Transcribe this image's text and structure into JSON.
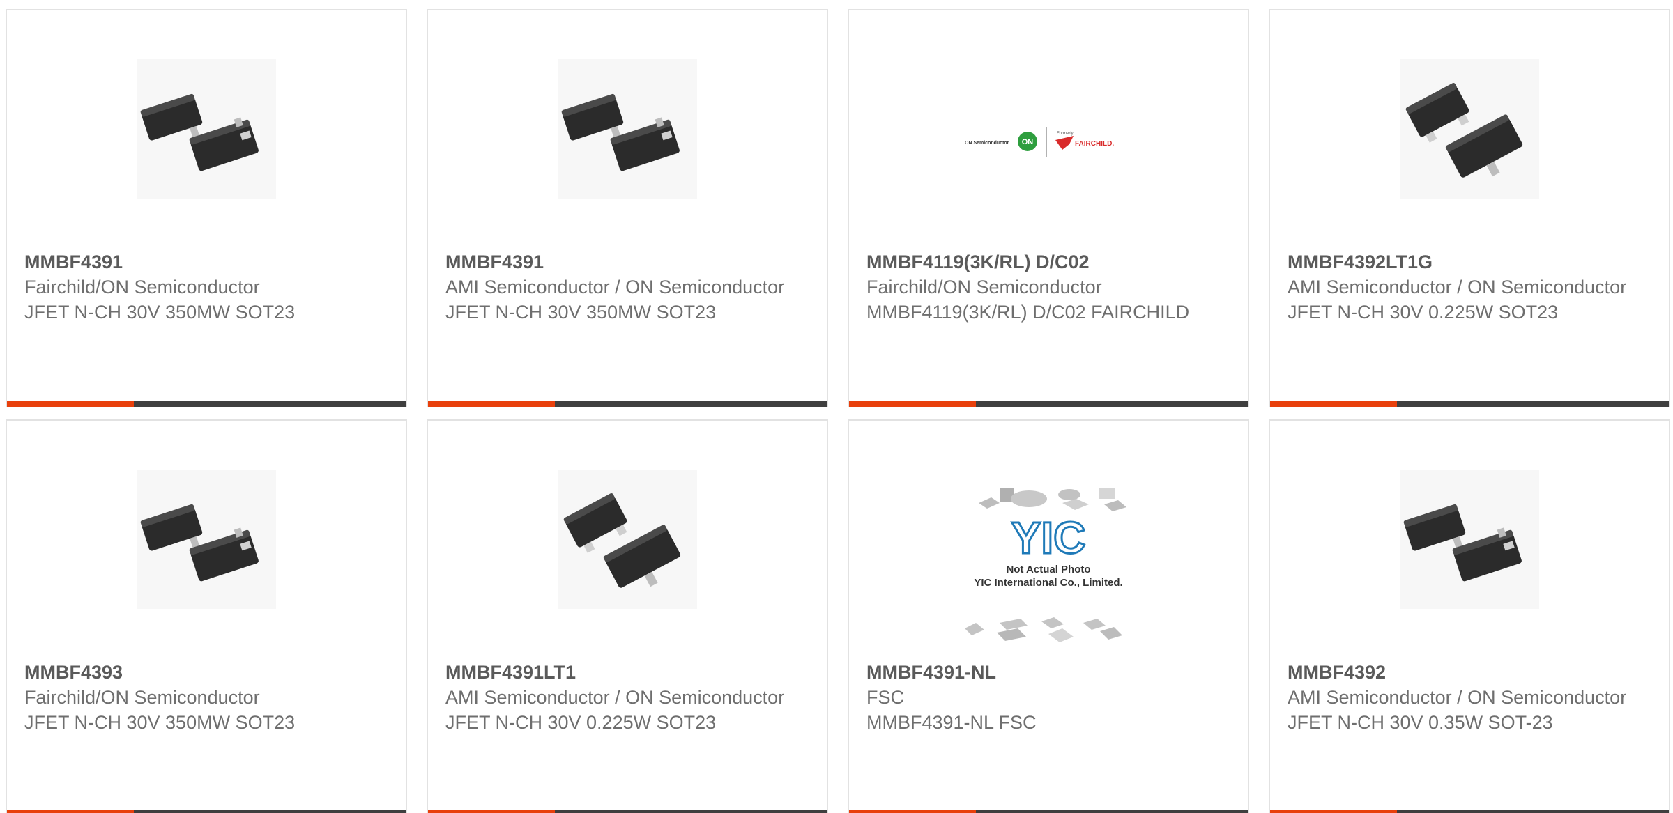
{
  "colors": {
    "accent_bar": "#e8400c",
    "dark_bar": "#3f3f3f",
    "card_border": "#e2e2e2",
    "text": "#6e6e6e"
  },
  "products": [
    {
      "part_number": "MMBF4391",
      "manufacturer": "Fairchild/ON Semiconductor",
      "description": "JFET N-CH 30V 350MW SOT23",
      "image": "sot23-package-icon"
    },
    {
      "part_number": "MMBF4391",
      "manufacturer": "AMI Semiconductor / ON Semiconductor",
      "description": "JFET N-CH 30V 350MW SOT23",
      "image": "sot23-package-icon"
    },
    {
      "part_number": "MMBF4119(3K/RL) D/C02",
      "manufacturer": "Fairchild/ON Semiconductor",
      "description": "MMBF4119(3K/RL) D/C02 FAIRCHILD",
      "image": "brand-logo-icon",
      "logo_text": {
        "left": "ON Semiconductor",
        "mark": "ON",
        "formerly": "Formerly",
        "right": "FAIRCHILD."
      }
    },
    {
      "part_number": "MMBF4392LT1G",
      "manufacturer": "AMI Semiconductor / ON Semiconductor",
      "description": "JFET N-CH 30V 0.225W SOT23",
      "image": "sot23-package-icon"
    },
    {
      "part_number": "MMBF4393",
      "manufacturer": "Fairchild/ON Semiconductor",
      "description": "JFET N-CH 30V 350MW SOT23",
      "image": "sot23-package-icon"
    },
    {
      "part_number": "MMBF4391LT1",
      "manufacturer": "AMI Semiconductor / ON Semiconductor",
      "description": "JFET N-CH 30V 0.225W SOT23",
      "image": "sot23-package-icon"
    },
    {
      "part_number": "MMBF4391-NL",
      "manufacturer": "FSC",
      "description": "MMBF4391-NL FSC",
      "image": "placeholder-photo-icon",
      "placeholder_text": {
        "logo": "YIC",
        "line1": "Not Actual Photo",
        "line2": "YIC International Co., Limited."
      }
    },
    {
      "part_number": "MMBF4392",
      "manufacturer": "AMI Semiconductor / ON Semiconductor",
      "description": "JFET N-CH 30V 0.35W SOT-23",
      "image": "sot23-package-icon"
    }
  ]
}
